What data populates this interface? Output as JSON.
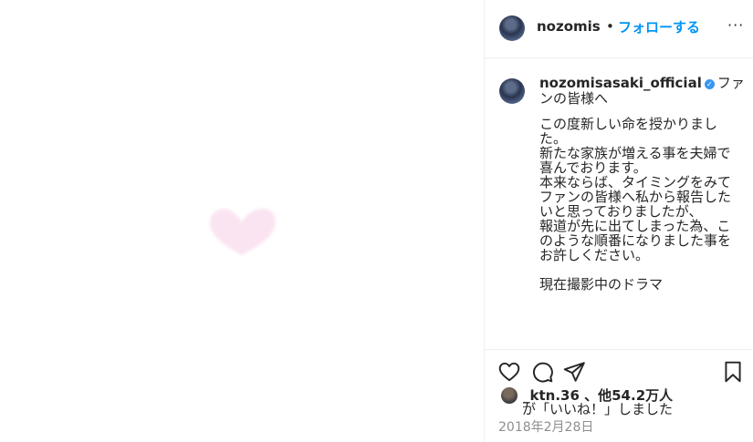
{
  "post": {
    "header": {
      "username": "nozomis",
      "separator": "•",
      "follow_label": "フォローする",
      "more_label": "···"
    },
    "caption": {
      "username": "nozomisasaki_official",
      "verified_mark": "✓",
      "title_text": "ファンの皆様へ",
      "body": "この度新しい命を授かりました。\n新たな家族が増える事を夫婦で\n喜んでおります。\n本来ならば、タイミングをみて\nファンの皆様へ私から報告したいと思っておりましたが、\n報道が先に出てしまった為、このような順番になりました事をお許しください。\n\n現在撮影中のドラマ"
    },
    "actions": {
      "like_icon": "heart-outline-icon",
      "comment_icon": "comment-icon",
      "share_icon": "paper-plane-icon",
      "save_icon": "bookmark-icon"
    },
    "likes": {
      "text": "_ktn.36 、他54.2万人",
      "suffix": "が「いいね！」しました"
    },
    "date": "2018年2月28日"
  },
  "colors": {
    "accent": "#0095f6",
    "verified": "#3897f0",
    "heart": "#fbe4f1",
    "muted": "#8e8e8e"
  }
}
